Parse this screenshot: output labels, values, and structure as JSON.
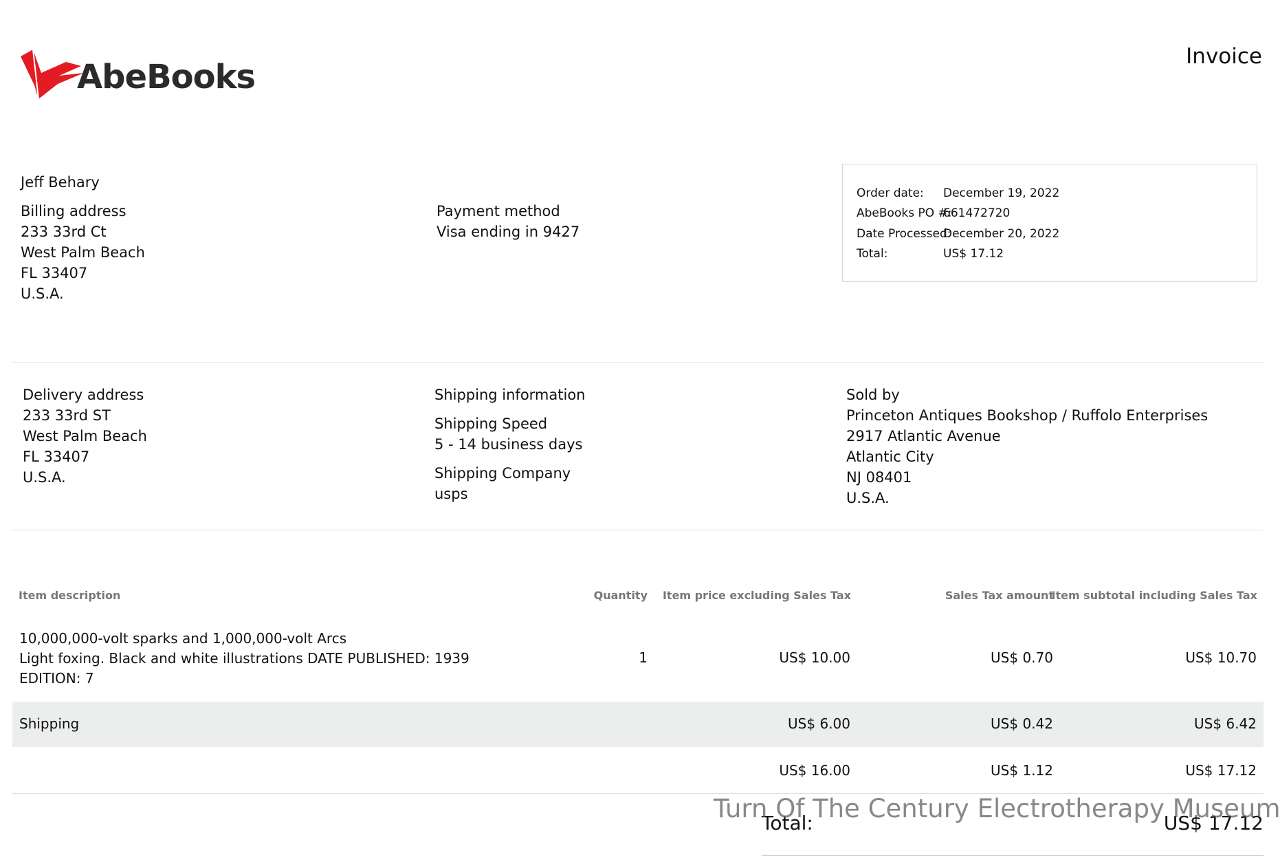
{
  "header": {
    "brand": "AbeBooks",
    "title": "Invoice"
  },
  "customer": {
    "name": "Jeff Behary",
    "billing_label": "Billing address",
    "billing_lines": [
      "233 33rd Ct",
      "West Palm Beach",
      "FL 33407",
      "U.S.A."
    ]
  },
  "payment": {
    "label": "Payment method",
    "value": "Visa ending in 9427"
  },
  "order": {
    "rows": [
      {
        "key": "Order date:",
        "value": "December 19, 2022"
      },
      {
        "key": "AbeBooks PO #:",
        "value": "661472720"
      },
      {
        "key": "Date Processed:",
        "value": "December 20, 2022"
      },
      {
        "key": "Total:",
        "value": "US$ 17.12"
      }
    ]
  },
  "delivery": {
    "label": "Delivery address",
    "lines": [
      "233 33rd ST",
      "West Palm Beach",
      "FL 33407",
      "U.S.A."
    ]
  },
  "shipping": {
    "label": "Shipping information",
    "speed_label": "Shipping Speed",
    "speed_value": "5 - 14 business days",
    "company_label": "Shipping Company",
    "company_value": "usps"
  },
  "seller": {
    "label": "Sold by",
    "lines": [
      "Princeton Antiques Bookshop / Ruffolo Enterprises",
      "2917 Atlantic Avenue",
      "Atlantic City",
      "NJ 08401",
      "U.S.A."
    ]
  },
  "table": {
    "headers": {
      "description": "Item description",
      "quantity": "Quantity",
      "price": "Item price excluding Sales Tax",
      "tax": "Sales Tax amount",
      "subtotal": "Item subtotal including Sales Tax"
    },
    "item": {
      "title": "10,000,000-volt sparks and 1,000,000-volt Arcs",
      "notes": "Light foxing. Black and white illustrations DATE PUBLISHED: 1939",
      "edition": "EDITION: 7",
      "quantity": "1",
      "price": "US$ 10.00",
      "tax": "US$ 0.70",
      "subtotal": "US$ 10.70"
    },
    "shipping_row": {
      "label": "Shipping",
      "price": "US$ 6.00",
      "tax": "US$ 0.42",
      "subtotal": "US$ 6.42"
    },
    "totals_row": {
      "price": "US$ 16.00",
      "tax": "US$ 1.12",
      "subtotal": "US$ 17.12"
    }
  },
  "grand_total": {
    "label": "Total:",
    "value": "US$ 17.12"
  },
  "watermark": "Turn Of The Century Electrotherapy Museum",
  "colors": {
    "brand_red": "#e31b23",
    "band": "#eceeee"
  }
}
